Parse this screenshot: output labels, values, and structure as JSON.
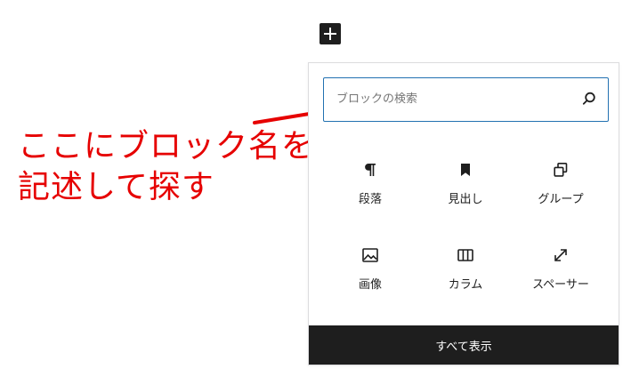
{
  "inserter": {
    "search": {
      "placeholder": "ブロックの検索",
      "value": ""
    },
    "blocks": [
      {
        "label": "段落",
        "icon": "paragraph-icon"
      },
      {
        "label": "見出し",
        "icon": "bookmark-icon"
      },
      {
        "label": "グループ",
        "icon": "group-icon"
      },
      {
        "label": "画像",
        "icon": "image-icon"
      },
      {
        "label": "カラム",
        "icon": "columns-icon"
      },
      {
        "label": "スペーサー",
        "icon": "resize-icon"
      }
    ],
    "browse_all_label": "すべて表示"
  },
  "annotation": {
    "line1": "ここにブロック名を",
    "line2": "記述して探す",
    "color": "#e60000"
  },
  "colors": {
    "focus_border": "#2271b1",
    "dark": "#1e1e1e"
  }
}
